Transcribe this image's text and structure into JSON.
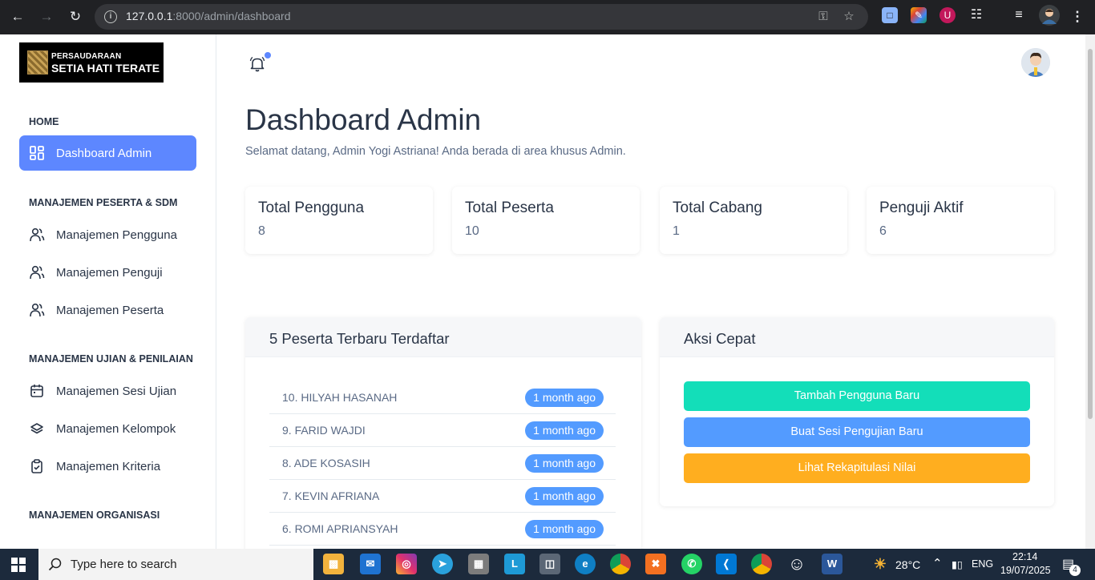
{
  "browser": {
    "url_host": "127.0.0.1",
    "url_path": ":8000/admin/dashboard"
  },
  "logo": {
    "line1": "PERSAUDARAAN",
    "line2": "SETIA HATI TERATE"
  },
  "sidebar": {
    "sections": [
      {
        "title": "HOME"
      },
      {
        "title": "MANAJEMEN PESERTA & SDM"
      },
      {
        "title": "MANAJEMEN UJIAN & PENILAIAN"
      },
      {
        "title": "MANAJEMEN ORGANISASI"
      }
    ],
    "items": [
      {
        "label": "Dashboard Admin",
        "icon": "dashboard-icon",
        "active": true
      },
      {
        "label": "Manajemen Pengguna",
        "icon": "users-icon"
      },
      {
        "label": "Manajemen Penguji",
        "icon": "users-icon"
      },
      {
        "label": "Manajemen Peserta",
        "icon": "users-icon"
      },
      {
        "label": "Manajemen Sesi Ujian",
        "icon": "calendar-icon"
      },
      {
        "label": "Manajemen Kelompok",
        "icon": "layers-icon"
      },
      {
        "label": "Manajemen Kriteria",
        "icon": "clipboard-check-icon"
      }
    ]
  },
  "header": {
    "title": "Dashboard Admin",
    "subtitle": "Selamat datang, Admin Yogi Astriana! Anda berada di area khusus Admin."
  },
  "stats": [
    {
      "label": "Total Pengguna",
      "value": "8"
    },
    {
      "label": "Total Peserta",
      "value": "10"
    },
    {
      "label": "Total Cabang",
      "value": "1"
    },
    {
      "label": "Penguji Aktif",
      "value": "6"
    }
  ],
  "recent": {
    "title": "5 Peserta Terbaru Terdaftar",
    "rows": [
      {
        "name": "10. HILYAH HASANAH",
        "time": "1 month ago"
      },
      {
        "name": "9. FARID WAJDI",
        "time": "1 month ago"
      },
      {
        "name": "8. ADE KOSASIH",
        "time": "1 month ago"
      },
      {
        "name": "7. KEVIN AFRIANA",
        "time": "1 month ago"
      },
      {
        "name": "6. ROMI APRIANSYAH",
        "time": "1 month ago"
      }
    ]
  },
  "quick": {
    "title": "Aksi Cepat",
    "buttons": [
      {
        "label": "Tambah Pengguna Baru",
        "color": "#13deb9"
      },
      {
        "label": "Buat Sesi Pengujian Baru",
        "color": "#539bff"
      },
      {
        "label": "Lihat Rekapitulasi Nilai",
        "color": "#ffae1f"
      }
    ]
  },
  "taskbar": {
    "search_placeholder": "Type here to search",
    "weather": "28°C",
    "lang": "ENG",
    "time": "22:14",
    "date": "19/07/2025",
    "notif_count": "4"
  },
  "colors": {
    "primary": "#5d87ff",
    "badge": "#539bff",
    "success": "#13deb9",
    "warning": "#ffae1f"
  }
}
